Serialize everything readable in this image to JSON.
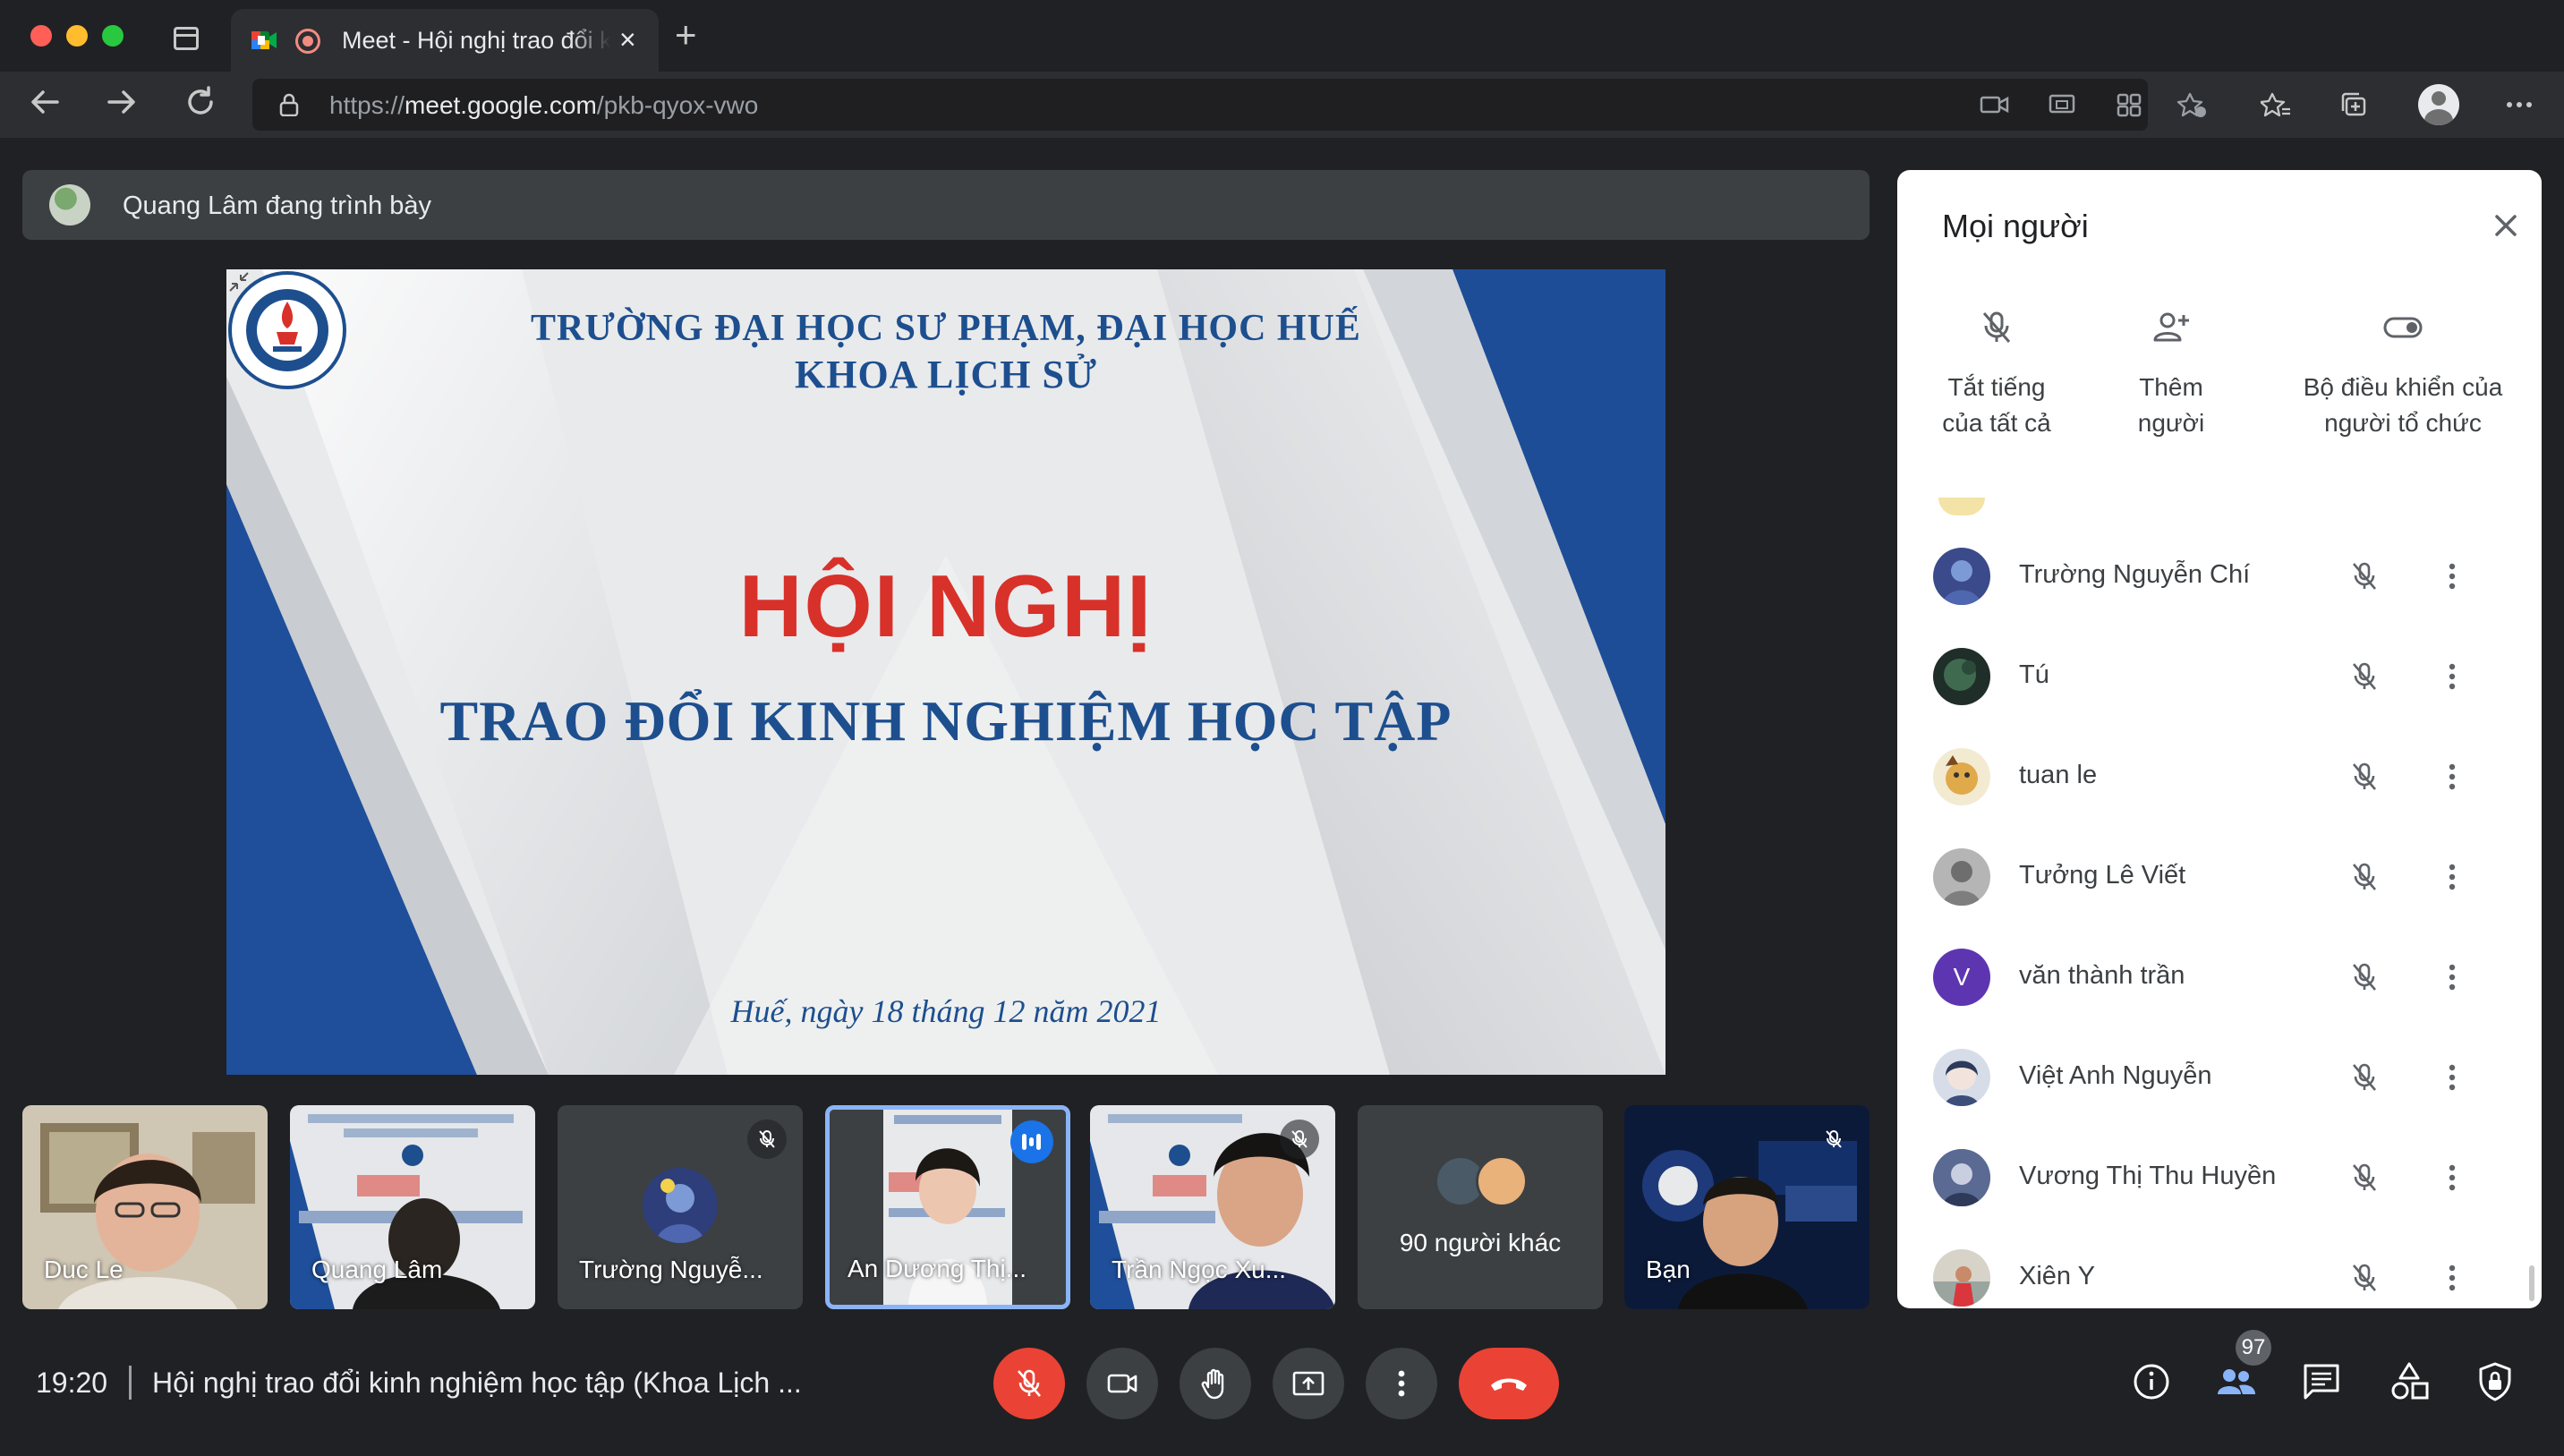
{
  "browser": {
    "tab_title": "Meet - Hội nghị trao đổi kinh nghiệm học tập",
    "url_prefix": "https://",
    "url_host": "meet.google.com",
    "url_path": "/pkb-qyox-vwo"
  },
  "presenter": {
    "text": "Quang Lâm đang trình bày"
  },
  "slide": {
    "university": "TRƯỜNG ĐẠI HỌC SƯ PHẠM, ĐẠI HỌC HUẾ",
    "department": "KHOA LỊCH SỬ",
    "title": "HỘI NGHỊ",
    "subtitle": "TRAO ĐỔI KINH NGHIỆM HỌC TẬP",
    "date": "Huế, ngày 18 tháng 12 năm 2021"
  },
  "tiles": [
    {
      "name": "Duc Le"
    },
    {
      "name": "Quang Lâm"
    },
    {
      "name": "Trường Nguyễ..."
    },
    {
      "name": "An Dương Thị..."
    },
    {
      "name": "Trần Ngọc Xu..."
    },
    {
      "name": "90 người khác"
    },
    {
      "name": "Bạn"
    }
  ],
  "panel": {
    "title": "Mọi người",
    "actions": [
      {
        "line1": "Tắt tiếng",
        "line2": "của tất cả"
      },
      {
        "line1": "Thêm",
        "line2": "người"
      },
      {
        "line1": "Bộ điều khiển của",
        "line2": "người tổ chức"
      }
    ],
    "participants": [
      {
        "name": "Trường Nguyễn Chí",
        "avatar_color": "#3b4a8a"
      },
      {
        "name": "Tú",
        "avatar_color": "#2f4a3a"
      },
      {
        "name": "tuan le",
        "avatar_color": "#d9a441"
      },
      {
        "name": "Tưởng Lê Viết",
        "avatar_color": "#9a9a9a"
      },
      {
        "name": "văn thành trần",
        "avatar_color": "#5e35b1",
        "initial": "V"
      },
      {
        "name": "Việt Anh Nguyễn",
        "avatar_color": "#5b6b8a"
      },
      {
        "name": "Vương Thị Thu Huyền",
        "avatar_color": "#7a86a8"
      },
      {
        "name": "Xiên Y",
        "avatar_color": "#c7c2b6"
      }
    ]
  },
  "bottom": {
    "time": "19:20",
    "meeting_title": "Hội nghị trao đổi kinh nghiệm học tập (Khoa Lịch ...",
    "people_count": "97"
  },
  "colors": {
    "accent": "#8ab4f8",
    "danger": "#ea4335",
    "slide_blue": "#1d4f8f",
    "slide_red": "#d8312a"
  }
}
